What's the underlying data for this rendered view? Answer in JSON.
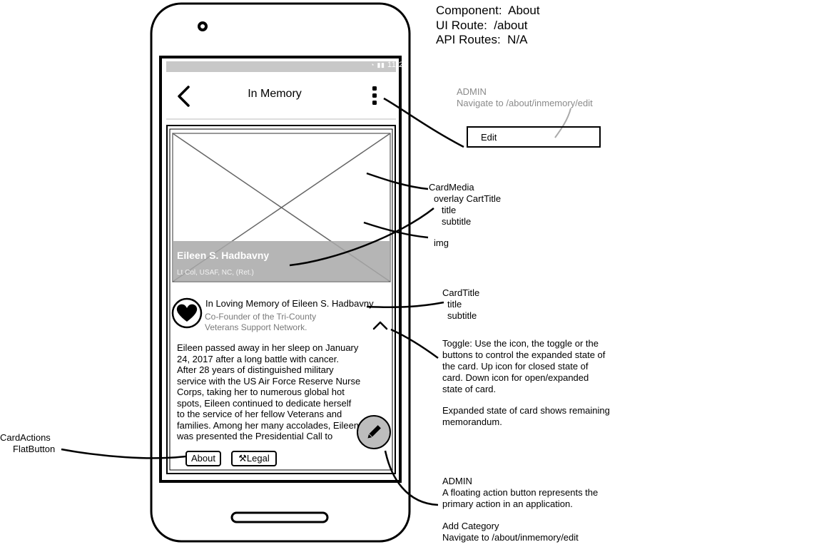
{
  "meta": {
    "component_label": "Component:",
    "component_value": "About",
    "ui_route_label": "UI Route:",
    "ui_route_value": "/about",
    "api_routes_label": "API Routes:",
    "api_routes_value": "N/A"
  },
  "phone": {
    "status_time": "11:25",
    "app_bar": {
      "title": "In Memory",
      "back_icon": "chevron-left-icon",
      "menu_icon": "more-vertical-icon"
    },
    "card": {
      "overlay_title": "Eileen S. Hadbavny",
      "overlay_subtitle": "Lt Col, USAF, NC, (Ret.)",
      "title": "In Loving Memory of Eileen S. Hadbavny",
      "subtitle_line1": "Co-Founder of the Tri-County",
      "subtitle_line2": "Veterans Support Network.",
      "avatar_icon": "heart-icon",
      "toggle_icon": "chevron-up-icon",
      "body_lines": [
        "Eileen passed away in her sleep on January",
        "24, 2017 after a long battle with cancer.",
        "After 28 years of distinguished military",
        "service with the US Air Force Reserve Nurse",
        "Corps, taking her to numerous global hot",
        "spots, Eileen continued to dedicate herself",
        "to the service of her fellow Veterans and",
        "families. Among her many accolades, Eileen",
        "was presented the Presidential Call to"
      ],
      "actions": {
        "about": "About",
        "legal": "Legal",
        "legal_icon": "gavel-icon"
      }
    },
    "fab_icon": "pencil-icon"
  },
  "annotations": {
    "admin_menu": {
      "line1": "ADMIN",
      "line2": "Navigate to /about/inmemory/edit"
    },
    "edit_menu_item": "Edit",
    "card_media": {
      "line1": "CardMedia",
      "line2": "overlay CartTitle",
      "line3": "title",
      "line4": "subtitle"
    },
    "img": "img",
    "card_title": {
      "line1": "CardTitle",
      "line2": "title",
      "line3": "subtitle"
    },
    "toggle": [
      "Toggle:  Use the icon, the toggle or the",
      "buttons to control the expanded state of",
      "the card.  Up icon for closed state of",
      "card.  Down icon for open/expanded",
      "state of card."
    ],
    "expanded": [
      "Expanded state of card shows remaining",
      "memorandum."
    ],
    "card_actions": {
      "line1": "CardActions",
      "line2": "FlatButton"
    },
    "fab_note": {
      "line1": "ADMIN",
      "line2": "A floating action button represents the",
      "line3": "primary action in an application.",
      "line4": "Add Category",
      "line5": "Navigate to /about/inmemory/edit"
    }
  },
  "colors": {
    "ink": "#000000",
    "muted_text": "#8a8a8a",
    "overlay": "#a8a8a8",
    "fab": "#bdbdbd",
    "status_bar": "#c8c8c8"
  }
}
